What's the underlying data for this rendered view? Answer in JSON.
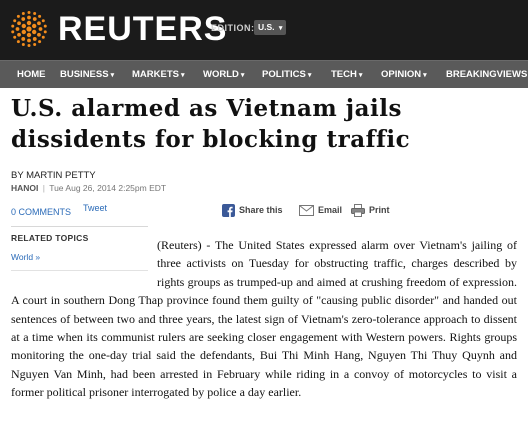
{
  "header": {
    "logo_text": "REUTERS",
    "logo_icon": "reuters-dots-icon",
    "edition_label": "EDITION:",
    "edition_value": "U.S.",
    "background": "#1b1b1b"
  },
  "nav": {
    "items": [
      {
        "label": "HOME",
        "has_menu": false
      },
      {
        "label": "BUSINESS",
        "has_menu": true
      },
      {
        "label": "MARKETS",
        "has_menu": true
      },
      {
        "label": "WORLD",
        "has_menu": true
      },
      {
        "label": "POLITICS",
        "has_menu": true
      },
      {
        "label": "TECH",
        "has_menu": true
      },
      {
        "label": "OPINION",
        "has_menu": true
      },
      {
        "label": "BREAKINGVIEWS",
        "has_menu": false
      }
    ],
    "background": "#5a5a5a"
  },
  "article": {
    "headline": "U.S. alarmed as Vietnam jails dissidents for blocking traffic",
    "byline": "BY MARTIN PETTY",
    "location": "HANOI",
    "separator": "|",
    "date": "Tue Aug 26, 2014 2:25pm EDT",
    "comments": "0 COMMENTS",
    "tweet": "Tweet",
    "share": {
      "share_label": "Share this",
      "email_label": "Email",
      "print_label": "Print"
    },
    "related": {
      "title": "RELATED TOPICS",
      "links": [
        "World »"
      ]
    },
    "body": "(Reuters) - The United States expressed alarm over Vietnam's jailing of three activists on Tuesday for obstructing traffic, charges described by rights groups as trumped-up and aimed at crushing freedom of expression. A court in southern Dong Thap province found them guilty of \"causing public disorder\" and handed out sentences of between two and three years, the latest sign of Vietnam's zero-tolerance approach to dissent at a time when its communist rulers are seeking closer engagement with Western powers. Rights groups monitoring the one-day trial said the defendants, Bui Thi Minh Hang, Nguyen Thi Thuy Quynh and Nguyen Van Minh, had been arrested in February while riding in a convoy of motorcycles to visit a former political prisoner interrogated by police a day earlier."
  },
  "colors": {
    "link": "#2b6bb8",
    "logo_orange": "#f28c1c",
    "facebook_blue": "#3b5998"
  }
}
